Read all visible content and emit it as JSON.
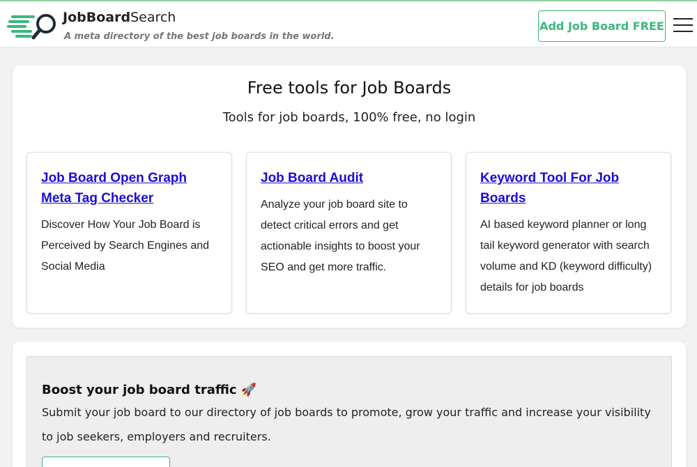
{
  "header": {
    "brand_bold": "JobBoard",
    "brand_rest": "Search",
    "tagline": "A meta directory of the best job boards in the world.",
    "add_button": "Add Job Board FREE"
  },
  "tools_section": {
    "title": "Free tools for Job Boards",
    "subtitle": "Tools for job boards, 100% free, no login",
    "items": [
      {
        "title": "Job Board Open Graph Meta Tag Checker",
        "description": "Discover How Your Job Board is Perceived by Search Engines and Social Media"
      },
      {
        "title": "Job Board Audit",
        "description": "Analyze your job board site to detect critical errors and get actionable insights to boost your SEO and get more traffic."
      },
      {
        "title": "Keyword Tool For Job Boards",
        "description": "AI based keyword planner or long tail keyword generator with search volume and KD (keyword difficulty) details for job boards"
      }
    ]
  },
  "promo": {
    "title": "Boost your job board traffic",
    "emoji": "🚀",
    "text": "Submit your job board to our directory of job boards to promote, grow your traffic and increase your visibility to job seekers, employers and recruiters."
  },
  "colors": {
    "accent": "#3bb77e",
    "link": "#1a0dd6",
    "logo_dark": "#1c2b3a"
  },
  "icons": {
    "logo": "magnifier-with-speed-lines-logo",
    "menu": "hamburger-menu-icon"
  }
}
